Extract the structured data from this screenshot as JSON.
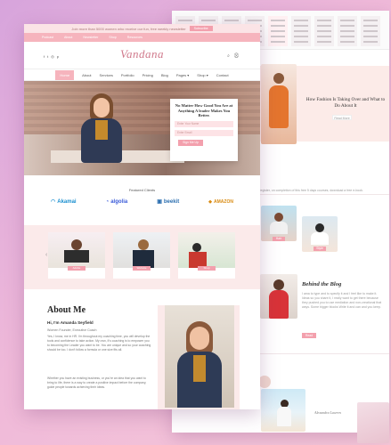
{
  "front": {
    "topbar": {
      "text": "Join more than 5000 women who receive our fun, free weekly newsletter",
      "button": "Subscribe"
    },
    "nav_top": [
      "Podcast",
      "About",
      "Newsletter",
      "Shop",
      "Resources"
    ],
    "brand": "Vandana",
    "nav_main": [
      {
        "label": "Home",
        "active": true
      },
      {
        "label": "About"
      },
      {
        "label": "Services"
      },
      {
        "label": "Portfolio"
      },
      {
        "label": "Pricing"
      },
      {
        "label": "Blog"
      },
      {
        "label": "Pages ▾"
      },
      {
        "label": "Shop ▾"
      },
      {
        "label": "Contact"
      }
    ],
    "optin": {
      "heading": "No Matter How Good You Are at Anything A leader Makes You Better.",
      "name_placeholder": "Enter Your Name",
      "email_placeholder": "Enter Email",
      "button": "Sign Me Up"
    },
    "featured": {
      "title": "Featured Clients",
      "logos": [
        "Akamai",
        "algolia",
        "beekit",
        "AMAZON"
      ]
    },
    "services": [
      {
        "label": "Adobe"
      },
      {
        "label": "Website"
      },
      {
        "label": "Shop"
      }
    ],
    "about": {
      "title": "About Me",
      "greeting": "Hi, I'm Amanda Seyfield",
      "role": "Women Founder, Executive Coach",
      "para1": "Yes, I know, me in HR. I'm throughout my coaching time, you will develop the tools and confidence to take action. My own, it's coaching is to empower you to becoming the Leader you want to be. You are unique and so your coaching should be too. I don't follow a formula or one size fits all.",
      "para2": "Whether you have an existing business, or you're an idea that you want to bring to life, there is a way to create a positive impact before the company, guide people towards achieving their ideas."
    }
  },
  "back": {
    "post_title": "How Fashion Is Taking Over and What to Do About It",
    "read_more": "Read More",
    "intro": "Register, on completion of this free 5 days courses, download a free e-book.",
    "gallery": [
      "Hair",
      "Style",
      "Yoga",
      "Travel"
    ],
    "behind": {
      "title": "Behind the Blog",
      "text": "I ama to type and to specify it and I feel like to make it. Ideas so you share it, I really want to get there because they pushed you to use mediation and non-creational that ways. Some bigger blocks Write it and can and you keep."
    },
    "button": "Read",
    "signature": "Alexandra Lawren"
  },
  "colors": {
    "accent": "#f3a0ad",
    "pink_bg": "#fbeaea",
    "brand": "#d07a8c"
  }
}
